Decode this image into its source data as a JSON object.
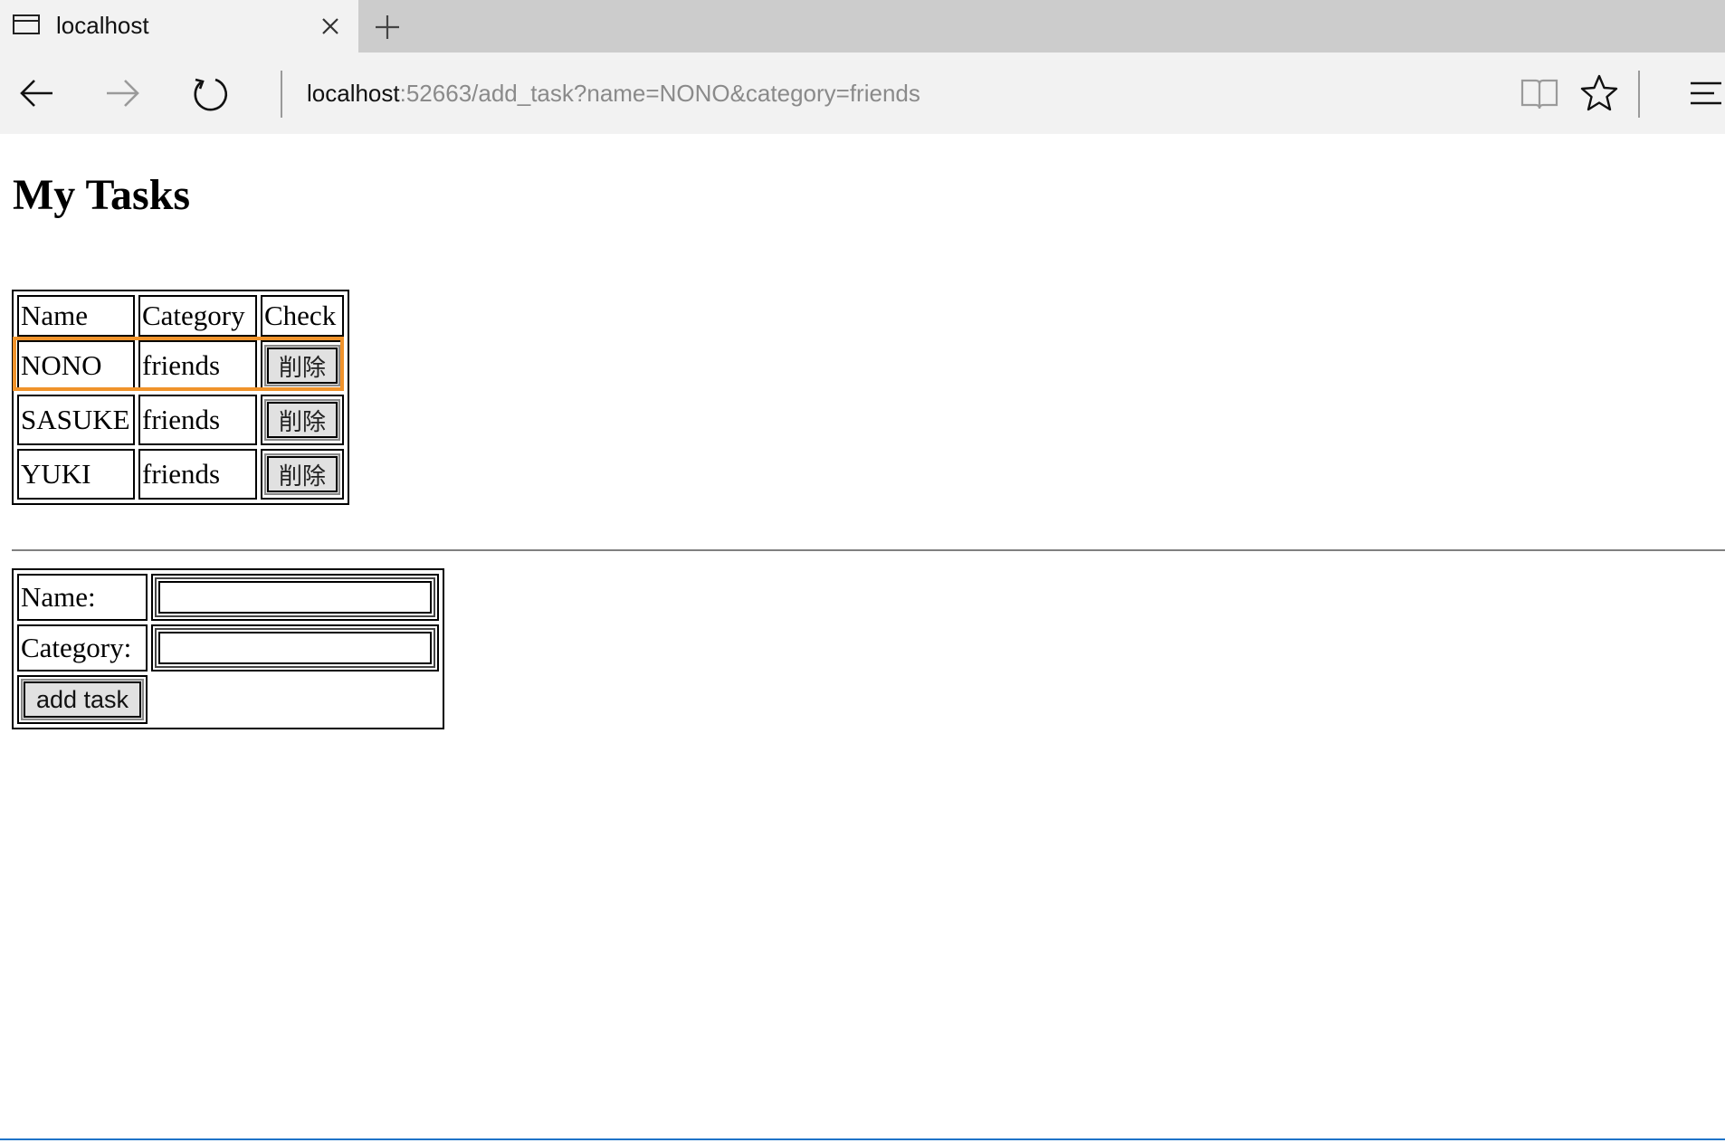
{
  "browser": {
    "tab_title": "localhost",
    "url_host": "localhost",
    "url_rest": ":52663/add_task?name=NONO&category=friends",
    "icons": [
      "window-icon",
      "close-icon",
      "plus-icon",
      "back-arrow-icon",
      "forward-arrow-icon",
      "refresh-icon",
      "reading-view-icon",
      "star-icon",
      "hub-menu-icon"
    ]
  },
  "page": {
    "title": "My Tasks"
  },
  "tasks_table": {
    "headers": [
      "Name",
      "Category",
      "Check"
    ],
    "rows": [
      {
        "name": "NONO",
        "category": "friends",
        "action": "削除"
      },
      {
        "name": "SASUKE",
        "category": "friends",
        "action": "削除"
      },
      {
        "name": "YUKI",
        "category": "friends",
        "action": "削除"
      }
    ]
  },
  "form": {
    "name_label": "Name:",
    "name_value": "",
    "category_label": "Category:",
    "category_value": "",
    "submit_label": "add task"
  },
  "colors": {
    "highlight": "#f0932b",
    "chrome_bg": "#f2f2f2",
    "tabstrip_bg": "#cccccc"
  }
}
